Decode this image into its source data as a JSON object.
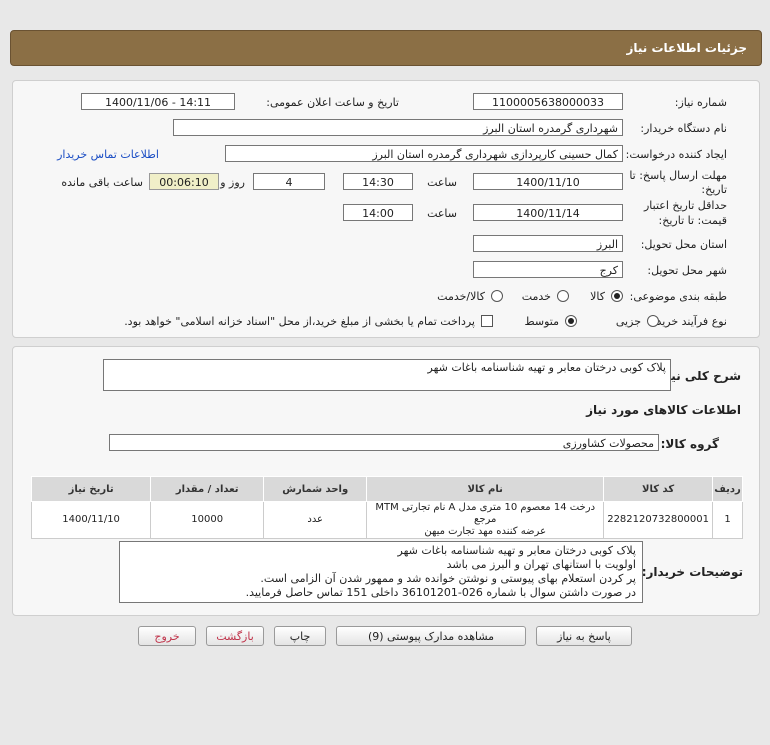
{
  "header": {
    "title": "جزئیات اطلاعات نیاز"
  },
  "form": {
    "need_number_label": "شماره نیاز:",
    "need_number": "1100005638000033",
    "announce_label": "تاریخ و ساعت اعلان عمومی:",
    "announce_value": "1400/11/06 - 14:11",
    "buyer_org_label": "نام دستگاه خریدار:",
    "buyer_org": "شهرداری گرمدره استان البرز",
    "requester_label": "ایجاد کننده درخواست:",
    "requester": "کمال حسینی کارپردازی شهرداری گرمدره استان البرز",
    "contact_link": "اطلاعات تماس خریدار",
    "deadline_label_1": "مهلت ارسال پاسخ: تا",
    "deadline_label_2": "تاریخ:",
    "deadline_date": "1400/11/10",
    "time_label": "ساعت",
    "deadline_time": "14:30",
    "days_value": "4",
    "days_label": "روز و",
    "timer_value": "00:06:10",
    "remaining_label": "ساعت باقی مانده",
    "validity_label_1": "حداقل تاریخ اعتبار",
    "validity_label_2": "قیمت: تا تاریخ:",
    "validity_date": "1400/11/14",
    "validity_time": "14:00",
    "province_label": "استان محل تحویل:",
    "province": "البرز",
    "city_label": "شهر محل تحویل:",
    "city": "کرج",
    "category_label": "طبقه بندی موضوعی:",
    "category_options": [
      "کالا",
      "خدمت",
      "کالا/خدمت"
    ],
    "category_selected": "کالا",
    "process_label": "نوع فرآیند خرید :",
    "process_options": [
      "جزیی",
      "متوسط"
    ],
    "process_selected": "متوسط",
    "payment_note": "پرداخت تمام یا بخشی از مبلغ خرید،از محل \"اسناد خزانه اسلامی\" خواهد بود."
  },
  "details": {
    "summary_label": "شرح کلی نیاز:",
    "summary": "پلاک کوبی درختان معابر و تهیه شناسنامه باغات شهر",
    "goods_info_title": "اطلاعات کالاهای مورد نیاز",
    "goods_group_label": "گروه کالا:",
    "goods_group": "محصولات کشاورزی",
    "table": {
      "headers": [
        "ردیف",
        "کد کالا",
        "نام کالا",
        "واحد شمارش",
        "تعداد / مقدار",
        "تاریخ نیاز"
      ],
      "rows": [
        {
          "row": "1",
          "code": "2282120732800001",
          "name_line1": "درخت 14 معصوم 10 متری مدل A نام تجارتی MTM مرجع",
          "name_line2": "عرضه کننده مهد تجارت میهن",
          "unit": "عدد",
          "qty": "10000",
          "date": "1400/11/10"
        }
      ]
    },
    "buyer_notes_label": "توضیحات خریدار:",
    "buyer_notes": [
      "پلاک کوبی درختان معابر و تهیه شناسنامه باغات شهر",
      "اولویت با استانهای تهران و البرز می باشد",
      "پر کردن استعلام بهای پیوستی و نوشتن خوانده شد و ممهور شدن آن الزامی است.",
      "در صورت داشتن سوال با شماره 026-36101201 داخلی 151 تماس حاصل فرمایید."
    ]
  },
  "buttons": {
    "reply": "پاسخ به نیاز",
    "attachments": "مشاهده مدارک پیوستی (9)",
    "print": "چاپ",
    "back": "بازگشت",
    "exit": "خروج"
  },
  "colors": {
    "header_bg": "#8b6f45",
    "link": "#1a4dc4",
    "timer_bg": "#f0efc8",
    "back_text": "#c0334a",
    "exit_text": "#c0334a"
  }
}
